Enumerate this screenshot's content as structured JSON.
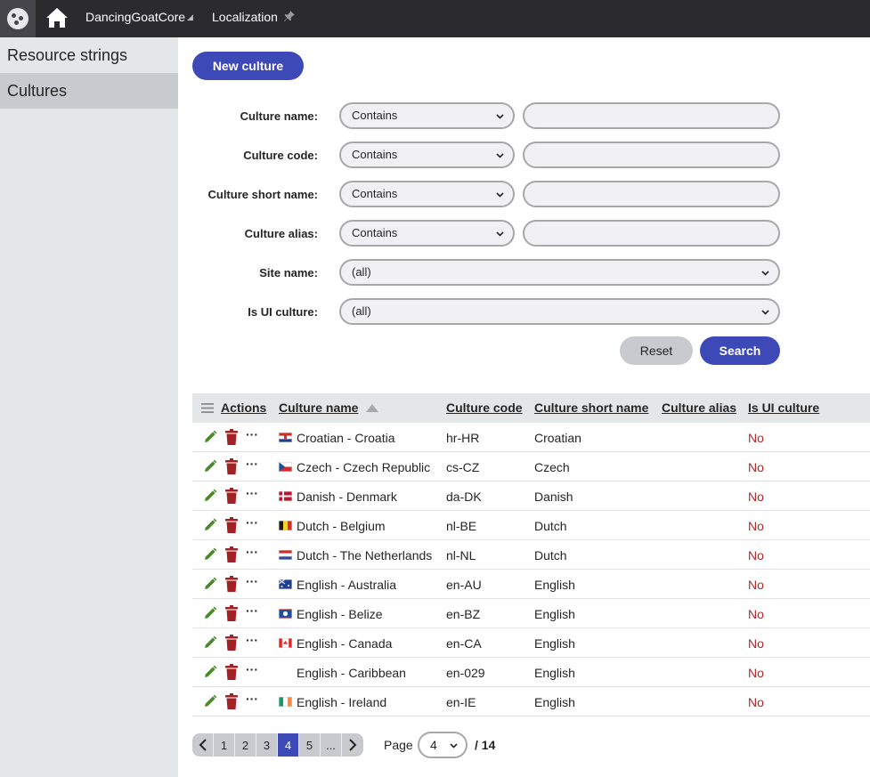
{
  "header": {
    "app_name": "DancingGoatCore",
    "module_name": "Localization"
  },
  "sidebar": {
    "items": [
      {
        "label": "Resource strings"
      },
      {
        "label": "Cultures"
      }
    ]
  },
  "toolbar": {
    "new_label": "New culture"
  },
  "filters": [
    {
      "label": "Culture name:",
      "operator": "Contains",
      "value": ""
    },
    {
      "label": "Culture code:",
      "operator": "Contains",
      "value": ""
    },
    {
      "label": "Culture short name:",
      "operator": "Contains",
      "value": ""
    },
    {
      "label": "Culture alias:",
      "operator": "Contains",
      "value": ""
    },
    {
      "label": "Site name:",
      "value": "(all)"
    },
    {
      "label": "Is UI culture:",
      "value": "(all)"
    }
  ],
  "filter_buttons": {
    "reset": "Reset",
    "search": "Search"
  },
  "grid": {
    "columns": [
      "Actions",
      "Culture name",
      "Culture code",
      "Culture short name",
      "Culture alias",
      "Is UI culture"
    ],
    "more_label": "···",
    "rows": [
      {
        "name": "Croatian - Croatia",
        "code": "hr-HR",
        "short": "Croatian",
        "alias": "",
        "ui": "No",
        "flag": "croatia"
      },
      {
        "name": "Czech - Czech Republic",
        "code": "cs-CZ",
        "short": "Czech",
        "alias": "",
        "ui": "No",
        "flag": "czech"
      },
      {
        "name": "Danish - Denmark",
        "code": "da-DK",
        "short": "Danish",
        "alias": "",
        "ui": "No",
        "flag": "denmark"
      },
      {
        "name": "Dutch - Belgium",
        "code": "nl-BE",
        "short": "Dutch",
        "alias": "",
        "ui": "No",
        "flag": "belgium"
      },
      {
        "name": "Dutch - The Netherlands",
        "code": "nl-NL",
        "short": "Dutch",
        "alias": "",
        "ui": "No",
        "flag": "netherlands"
      },
      {
        "name": "English - Australia",
        "code": "en-AU",
        "short": "English",
        "alias": "",
        "ui": "No",
        "flag": "australia"
      },
      {
        "name": "English - Belize",
        "code": "en-BZ",
        "short": "English",
        "alias": "",
        "ui": "No",
        "flag": "belize"
      },
      {
        "name": "English - Canada",
        "code": "en-CA",
        "short": "English",
        "alias": "",
        "ui": "No",
        "flag": "canada"
      },
      {
        "name": "English - Caribbean",
        "code": "en-029",
        "short": "English",
        "alias": "",
        "ui": "No",
        "flag": ""
      },
      {
        "name": "English - Ireland",
        "code": "en-IE",
        "short": "English",
        "alias": "",
        "ui": "No",
        "flag": "ireland"
      }
    ]
  },
  "pager": {
    "pages": [
      "1",
      "2",
      "3",
      "4",
      "5",
      "..."
    ],
    "current": "4",
    "page_label": "Page",
    "page_select": "4",
    "total": "/ 14"
  },
  "colors": {
    "primary": "#3e49b8",
    "topbar": "#2b2b2f",
    "no": "#b12628",
    "edit": "#4a8a2a",
    "delete": "#a32024"
  }
}
